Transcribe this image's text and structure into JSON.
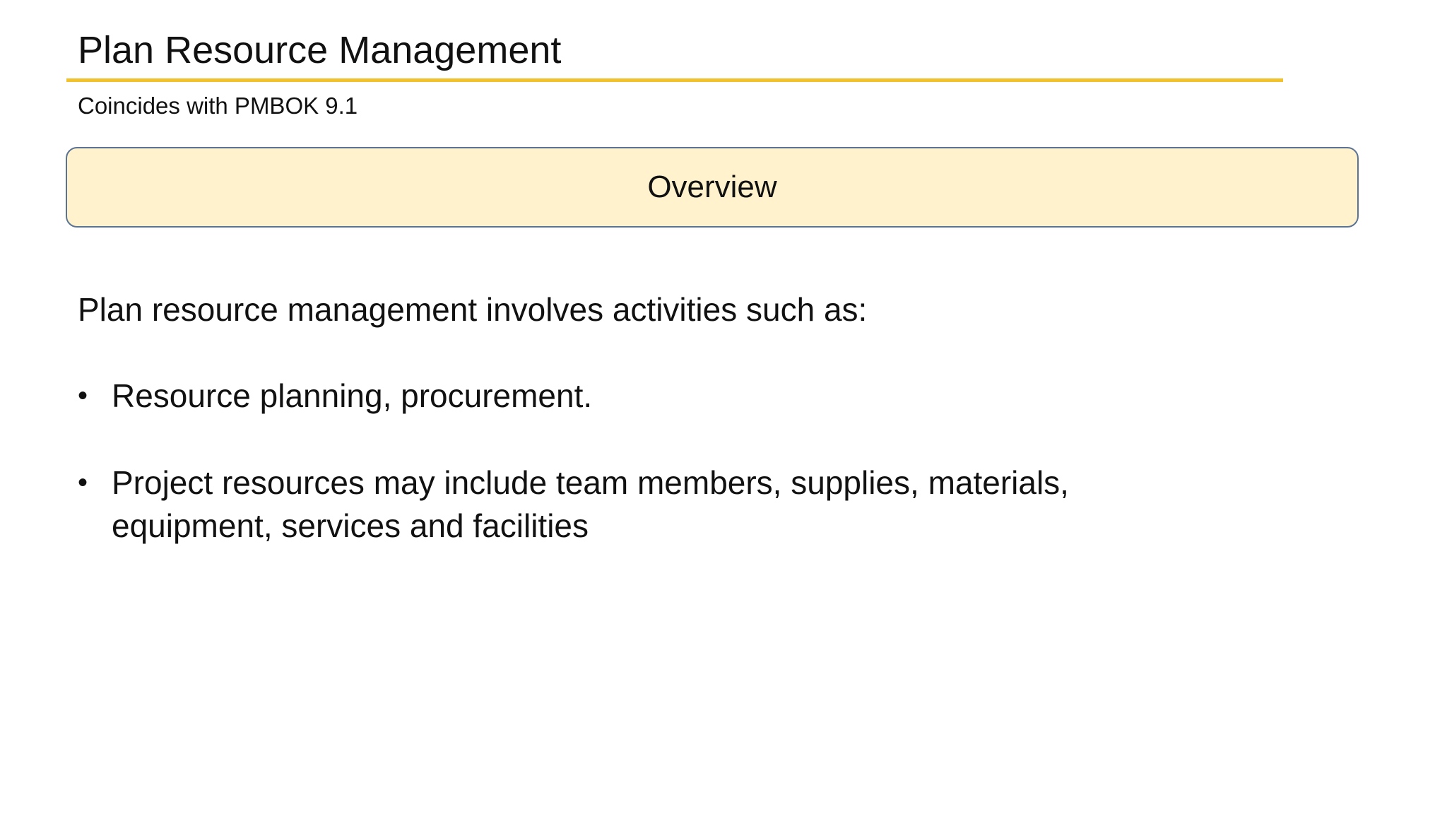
{
  "slide": {
    "title": "Plan Resource Management",
    "subtitle": "Coincides with PMBOK 9.1",
    "overview_label": "Overview",
    "intro": "Plan resource management involves activities such as:",
    "bullets": [
      "Resource planning, procurement.",
      "Project resources may include team members, supplies, materials, equipment, services and facilities"
    ],
    "bullet_glyph": "•",
    "colors": {
      "accent_rule": "#f2c22a",
      "overview_fill": "#fff2cc",
      "overview_border": "#5b7395"
    }
  }
}
